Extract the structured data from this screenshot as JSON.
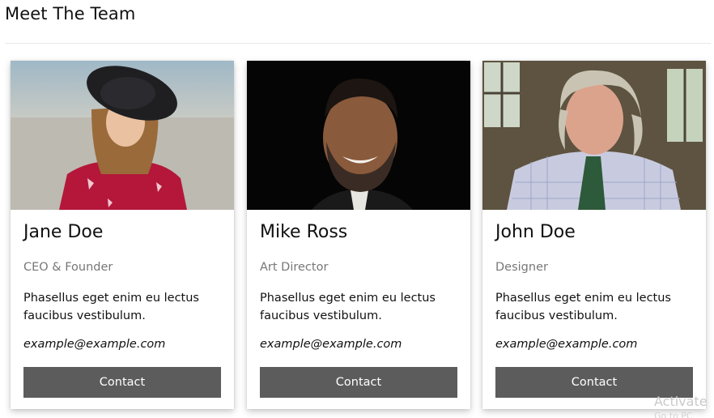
{
  "page": {
    "title": "Meet The Team"
  },
  "team": [
    {
      "name": "Jane Doe",
      "role": "CEO & Founder",
      "description": "Phasellus eget enim eu lectus faucibus vestibulum.",
      "email": "example@example.com",
      "button_label": "Contact"
    },
    {
      "name": "Mike Ross",
      "role": "Art Director",
      "description": "Phasellus eget enim eu lectus faucibus vestibulum.",
      "email": "example@example.com",
      "button_label": "Contact"
    },
    {
      "name": "John Doe",
      "role": "Designer",
      "description": "Phasellus eget enim eu lectus faucibus vestibulum.",
      "email": "example@example.com",
      "button_label": "Contact"
    }
  ],
  "overlay": {
    "watermark": "Activate",
    "watermark_sub": "Go to PC"
  },
  "colors": {
    "button_bg": "#5c5c5c",
    "button_text": "#ffffff",
    "role_text": "#777777"
  }
}
